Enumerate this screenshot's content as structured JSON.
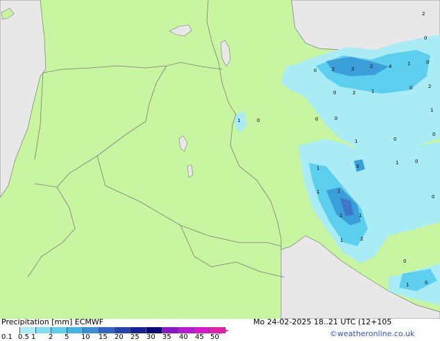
{
  "title": "Precipitation [mm]  ECMWF",
  "valid_time": "Mo 24-02-2025 18..21 UTC (12+105",
  "credit": "©weatheronline.co.uk",
  "colors": {
    "land": "#c8f5a0",
    "sea": "#e8e8e8",
    "border": "#7a7a7a",
    "precip_light": "#a9ecf5",
    "precip_mid": "#5ccfee",
    "precip_heavy": "#3a9ed8",
    "precip_core": "#3f76c8"
  },
  "legend": {
    "ticks": [
      "0.1",
      "0.5",
      "1",
      "2",
      "5",
      "10",
      "15",
      "20",
      "25",
      "30",
      "35",
      "40",
      "45",
      "50"
    ],
    "colors": [
      "#ffffff",
      "#a9ecf5",
      "#7fdcf3",
      "#5ccfee",
      "#3fb4e6",
      "#3a8fd8",
      "#2f66c8",
      "#2342b0",
      "#18209a",
      "#0c0a7a",
      "#8a18c8",
      "#b818d8",
      "#d818d0",
      "#e020a8"
    ]
  },
  "labels": [
    {
      "text": "2"
    },
    {
      "text": "0"
    },
    {
      "text": "0"
    },
    {
      "text": "2"
    },
    {
      "text": "3"
    },
    {
      "text": "2"
    },
    {
      "text": "4"
    },
    {
      "text": "1"
    },
    {
      "text": "0"
    },
    {
      "text": "0"
    },
    {
      "text": "2"
    },
    {
      "text": "1"
    },
    {
      "text": "0"
    },
    {
      "text": "2"
    },
    {
      "text": "1"
    },
    {
      "text": "0"
    },
    {
      "text": "1"
    },
    {
      "text": "0"
    },
    {
      "text": "0"
    },
    {
      "text": "0"
    },
    {
      "text": "1"
    },
    {
      "text": "0"
    },
    {
      "text": "0"
    },
    {
      "text": "1"
    },
    {
      "text": "3"
    },
    {
      "text": "1"
    },
    {
      "text": "0"
    },
    {
      "text": "1"
    },
    {
      "text": "1"
    },
    {
      "text": "1"
    },
    {
      "text": "1"
    },
    {
      "text": "2"
    },
    {
      "text": "1"
    },
    {
      "text": "0"
    },
    {
      "text": "1"
    },
    {
      "text": "0"
    }
  ]
}
